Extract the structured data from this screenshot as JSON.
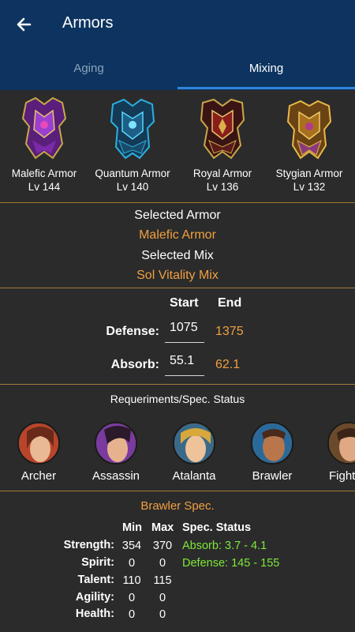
{
  "appbar": {
    "title": "Armors",
    "back_icon": "arrow-left-icon"
  },
  "tabs": [
    {
      "label": "Aging",
      "selected": false
    },
    {
      "label": "Mixing",
      "selected": true
    }
  ],
  "armors": [
    {
      "name": "Malefic Armor",
      "level": "Lv 144",
      "icon": "armor-icon",
      "color": "#8a3bb8"
    },
    {
      "name": "Quantum Armor",
      "level": "Lv 140",
      "icon": "armor-icon",
      "color": "#2aa7d8"
    },
    {
      "name": "Royal Armor",
      "level": "Lv 136",
      "icon": "armor-icon",
      "color": "#b8282a"
    },
    {
      "name": "Stygian Armor",
      "level": "Lv 132",
      "icon": "armor-icon",
      "color": "#c98a2a"
    }
  ],
  "selection": {
    "armor_label": "Selected Armor",
    "armor_value": "Malefic Armor",
    "mix_label": "Selected Mix",
    "mix_value": "Sol Vitality Mix"
  },
  "stats": {
    "start_header": "Start",
    "end_header": "End",
    "defense": {
      "label": "Defense:",
      "start": "1075",
      "end": "1375"
    },
    "absorb": {
      "label": "Absorb:",
      "start": "55.1",
      "end": "62.1"
    }
  },
  "requirements": {
    "title": "Requeriments/Spec. Status",
    "characters": [
      {
        "name": "Archer",
        "icon": "archer-avatar-icon"
      },
      {
        "name": "Assassin",
        "icon": "assassin-avatar-icon"
      },
      {
        "name": "Atalanta",
        "icon": "atalanta-avatar-icon"
      },
      {
        "name": "Brawler",
        "icon": "brawler-avatar-icon"
      },
      {
        "name": "Fighter",
        "icon": "fighter-avatar-icon"
      }
    ]
  },
  "spec": {
    "title": "Brawler Spec.",
    "min_header": "Min",
    "max_header": "Max",
    "status_header": "Spec. Status",
    "rows": [
      {
        "label": "Strength:",
        "min": "354",
        "max": "370",
        "status": "Absorb: 3.7 - 4.1"
      },
      {
        "label": "Spirit:",
        "min": "0",
        "max": "0",
        "status": "Defense: 145 - 155"
      },
      {
        "label": "Talent:",
        "min": "110",
        "max": "115",
        "status": ""
      },
      {
        "label": "Agility:",
        "min": "0",
        "max": "0",
        "status": ""
      },
      {
        "label": "Health:",
        "min": "0",
        "max": "0",
        "status": ""
      }
    ]
  }
}
